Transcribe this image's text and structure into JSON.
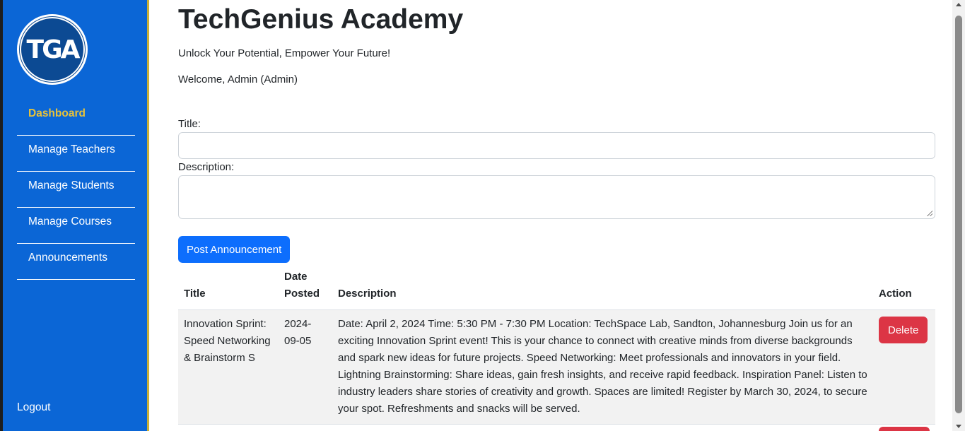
{
  "sidebar": {
    "logo_text": "TGA",
    "items": [
      {
        "label": "Dashboard",
        "active": true
      },
      {
        "label": "Manage Teachers",
        "active": false
      },
      {
        "label": "Manage Students",
        "active": false
      },
      {
        "label": "Manage Courses",
        "active": false
      },
      {
        "label": "Announcements",
        "active": false
      }
    ],
    "logout_label": "Logout"
  },
  "header": {
    "title": "TechGenius Academy",
    "tagline": "Unlock Your Potential, Empower Your Future!",
    "welcome": "Welcome, Admin (Admin)"
  },
  "form": {
    "title_label": "Title:",
    "title_value": "",
    "description_label": "Description:",
    "description_value": "",
    "submit_label": "Post Announcement"
  },
  "table": {
    "headers": {
      "title": "Title",
      "date": "Date Posted",
      "description": "Description",
      "action": "Action"
    },
    "rows": [
      {
        "title": "Innovation Sprint: Speed Networking & Brainstorm S",
        "date": "2024-09-05",
        "description": "Date: April 2, 2024 Time: 5:30 PM - 7:30 PM Location: TechSpace Lab, Sandton, Johannesburg Join us for an exciting Innovation Sprint event! This is your chance to connect with creative minds from diverse backgrounds and spark new ideas for future projects. Speed Networking: Meet professionals and innovators in your field. Lightning Brainstorming: Share ideas, gain fresh insights, and receive rapid feedback. Inspiration Panel: Listen to industry leaders share stories of creativity and growth. Spaces are limited! Register by March 30, 2024, to secure your spot. Refreshments and snacks will be served.",
        "action_label": "Delete"
      }
    ]
  },
  "colors": {
    "sidebar_bg": "#0b66d6",
    "active_nav": "#e8c23a",
    "primary": "#0d6efd",
    "danger": "#dc3545"
  }
}
